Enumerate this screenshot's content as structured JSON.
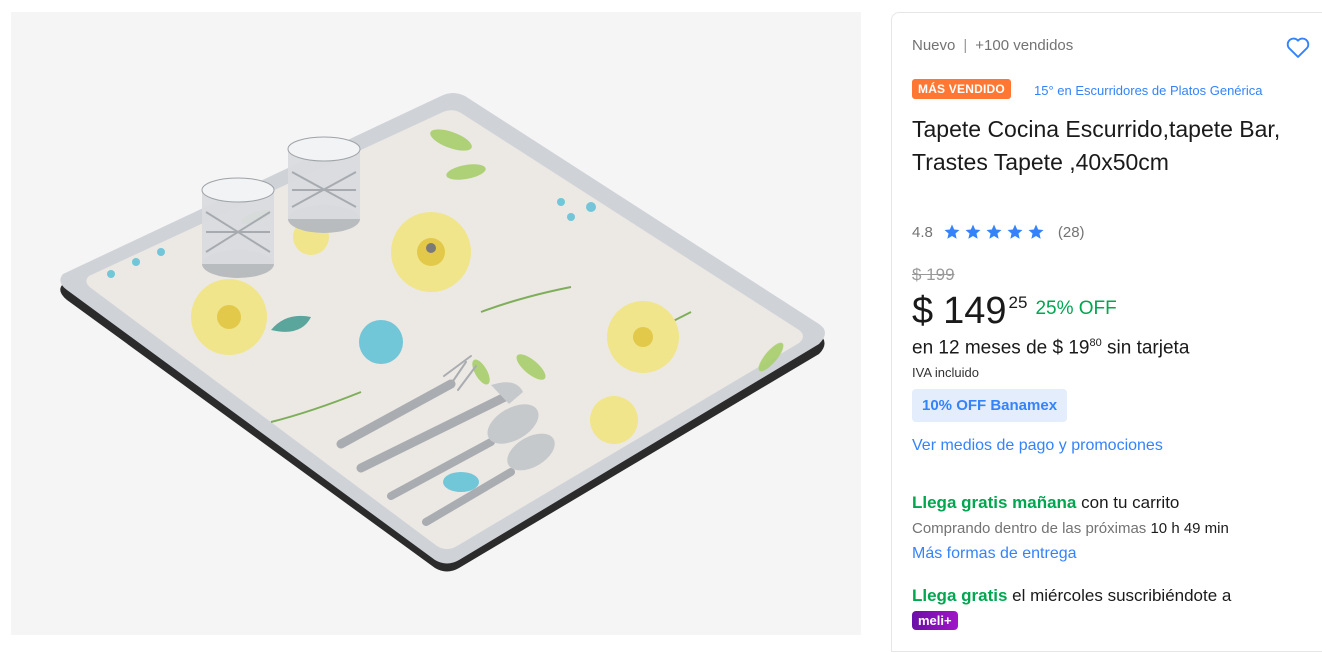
{
  "gallery": {
    "image_alt": "Tapete Cocina Escurrido, tapete Bar, Trastes Tapete, 40x50cm"
  },
  "header": {
    "condition": "Nuevo",
    "separator": "|",
    "sold": "+100 vendidos",
    "favorite_icon": "heart-icon"
  },
  "badge": {
    "label": "MÁS VENDIDO",
    "color": "#ff7733",
    "rank": "15° en Escurridores de Platos Genérica"
  },
  "product": {
    "title": "Tapete Cocina Escurrido,tapete Bar, Trastes Tapete ,40x50cm"
  },
  "rating": {
    "score": "4.8",
    "stars": 4.8,
    "reviews": "(28)",
    "star_color": "#3483fa"
  },
  "price": {
    "original": "$ 199",
    "currency": "$",
    "integer": "149",
    "cents": "25",
    "discount": "25% OFF",
    "installments_prefix": "en 12 meses de",
    "installment_currency": "$",
    "installment_integer": "19",
    "installment_cents": "80",
    "installments_suffix": "sin tarjeta",
    "tax_note": "IVA incluido"
  },
  "promo": {
    "label": "10% OFF Banamex",
    "payment_link": "Ver medios de pago y promociones"
  },
  "shipping": {
    "fast_bold": "Llega gratis mañana",
    "fast_rest": "con tu carrito",
    "countdown_prefix": "Comprando dentro de las próximas",
    "countdown": "10 h 49 min",
    "more_link": "Más formas de entrega",
    "sub_bold": "Llega gratis",
    "sub_rest": "el miércoles suscribiéndote a",
    "meli_badge": "meli+"
  },
  "colors": {
    "accent": "#3483fa",
    "green": "#00a650",
    "meli": "#6b0fa5"
  }
}
